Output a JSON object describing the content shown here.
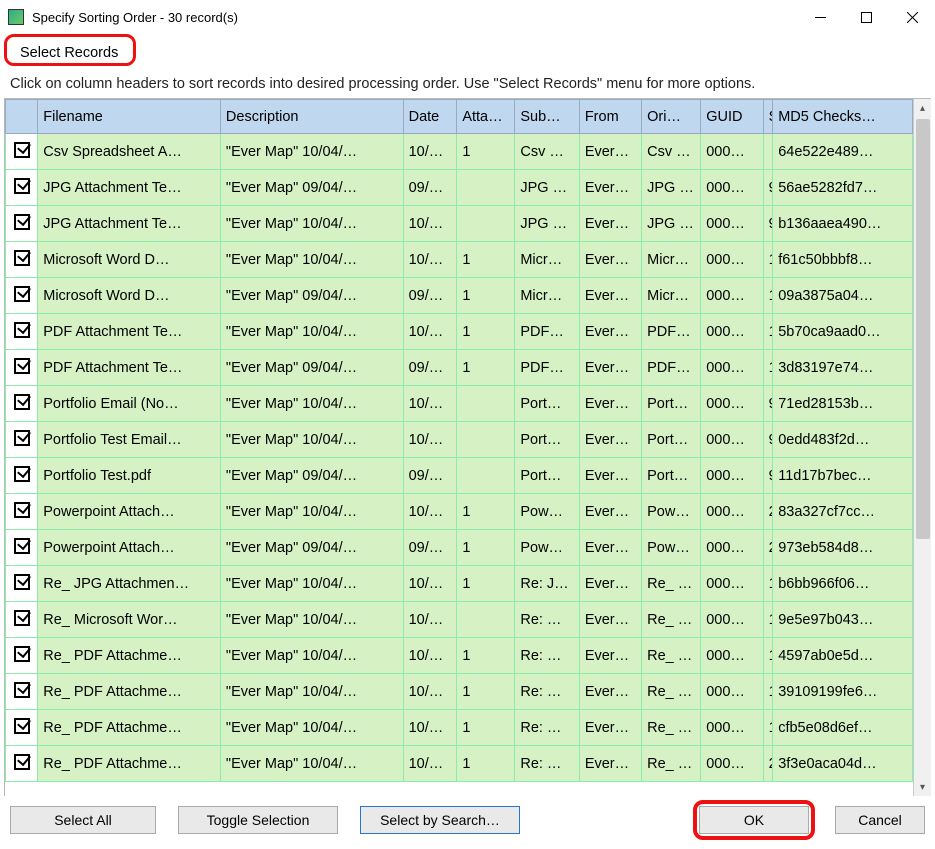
{
  "window": {
    "title": "Specify Sorting Order - 30 record(s)"
  },
  "menu": {
    "select_records": "Select Records"
  },
  "instruction": "Click on column headers to sort records into desired processing order. Use \"Select Records\" menu for more options.",
  "headers": {
    "filename": "Filename",
    "description": "Description",
    "date": "Date",
    "atta": "Atta…",
    "sub": "Sub…",
    "from": "From",
    "ori": "Ori…",
    "guid": "GUID",
    "q": "S",
    "md5": "MD5 Checks…"
  },
  "rows": [
    {
      "fn": "Csv Spreadsheet A…",
      "desc": "\"Ever Map\" 10/04/…",
      "date": "10/…",
      "att": "1",
      "sub": "Csv …",
      "from": "Ever…",
      "ori": "Csv …",
      "guid": "000…",
      "q": "",
      "md5": "64e522e489…"
    },
    {
      "fn": "JPG Attachment Te…",
      "desc": "\"Ever Map\" 09/04/…",
      "date": "09/…",
      "att": "",
      "sub": "JPG …",
      "from": "Ever…",
      "ori": "JPG …",
      "guid": "000…",
      "q": "9",
      "md5": "56ae5282fd7…"
    },
    {
      "fn": "JPG Attachment Te…",
      "desc": "\"Ever Map\" 10/04/…",
      "date": "10/…",
      "att": "",
      "sub": "JPG …",
      "from": "Ever…",
      "ori": "JPG …",
      "guid": "000…",
      "q": "9",
      "md5": "b136aaea490…"
    },
    {
      "fn": "Microsoft Word D…",
      "desc": "\"Ever Map\" 10/04/…",
      "date": "10/…",
      "att": "1",
      "sub": "Micr…",
      "from": "Ever…",
      "ori": "Micr…",
      "guid": "000…",
      "q": "1",
      "md5": "f61c50bbbf8…"
    },
    {
      "fn": "Microsoft Word D…",
      "desc": "\"Ever Map\" 09/04/…",
      "date": "09/…",
      "att": "1",
      "sub": "Micr…",
      "from": "Ever…",
      "ori": "Micr…",
      "guid": "000…",
      "q": "1",
      "md5": "09a3875a04…"
    },
    {
      "fn": "PDF Attachment Te…",
      "desc": "\"Ever Map\" 10/04/…",
      "date": "10/…",
      "att": "1",
      "sub": "PDF…",
      "from": "Ever…",
      "ori": "PDF…",
      "guid": "000…",
      "q": "1",
      "md5": "5b70ca9aad0…"
    },
    {
      "fn": "PDF Attachment Te…",
      "desc": "\"Ever Map\" 09/04/…",
      "date": "09/…",
      "att": "1",
      "sub": "PDF…",
      "from": "Ever…",
      "ori": "PDF…",
      "guid": "000…",
      "q": "1",
      "md5": "3d83197e74…"
    },
    {
      "fn": "Portfolio Email (No…",
      "desc": "\"Ever Map\" 10/04/…",
      "date": "10/…",
      "att": "",
      "sub": "Port…",
      "from": "Ever…",
      "ori": "Port…",
      "guid": "000…",
      "q": "9",
      "md5": "71ed28153b…"
    },
    {
      "fn": "Portfolio Test Email…",
      "desc": "\"Ever Map\" 10/04/…",
      "date": "10/…",
      "att": "",
      "sub": "Port…",
      "from": "Ever…",
      "ori": "Port…",
      "guid": "000…",
      "q": "9",
      "md5": "0edd483f2d…"
    },
    {
      "fn": "Portfolio Test.pdf",
      "desc": "\"Ever Map\" 09/04/…",
      "date": "09/…",
      "att": "",
      "sub": "Port…",
      "from": "Ever…",
      "ori": "Port…",
      "guid": "000…",
      "q": "9",
      "md5": "11d17b7bec…"
    },
    {
      "fn": "Powerpoint Attach…",
      "desc": "\"Ever Map\" 10/04/…",
      "date": "10/…",
      "att": "1",
      "sub": "Pow…",
      "from": "Ever…",
      "ori": "Pow…",
      "guid": "000…",
      "q": "2",
      "md5": "83a327cf7cc…"
    },
    {
      "fn": "Powerpoint Attach…",
      "desc": "\"Ever Map\" 09/04/…",
      "date": "09/…",
      "att": "1",
      "sub": "Pow…",
      "from": "Ever…",
      "ori": "Pow…",
      "guid": "000…",
      "q": "2",
      "md5": "973eb584d8…"
    },
    {
      "fn": "Re_ JPG Attachmen…",
      "desc": "\"Ever Map\" 10/04/…",
      "date": "10/…",
      "att": "1",
      "sub": "Re: J…",
      "from": "Ever…",
      "ori": "Re_ …",
      "guid": "000…",
      "q": "1",
      "md5": "b6bb966f06…"
    },
    {
      "fn": "Re_ Microsoft Wor…",
      "desc": "\"Ever Map\" 10/04/…",
      "date": "10/…",
      "att": "",
      "sub": "Re: …",
      "from": "Ever…",
      "ori": "Re_ …",
      "guid": "000…",
      "q": "1",
      "md5": "9e5e97b043…"
    },
    {
      "fn": "Re_ PDF Attachme…",
      "desc": "\"Ever Map\" 10/04/…",
      "date": "10/…",
      "att": "1",
      "sub": "Re: …",
      "from": "Ever…",
      "ori": "Re_ …",
      "guid": "000…",
      "q": "1",
      "md5": "4597ab0e5d…"
    },
    {
      "fn": "Re_ PDF Attachme…",
      "desc": "\"Ever Map\" 10/04/…",
      "date": "10/…",
      "att": "1",
      "sub": "Re: …",
      "from": "Ever…",
      "ori": "Re_ …",
      "guid": "000…",
      "q": "1",
      "md5": "39109199fe6…"
    },
    {
      "fn": "Re_ PDF Attachme…",
      "desc": "\"Ever Map\" 10/04/…",
      "date": "10/…",
      "att": "1",
      "sub": "Re: …",
      "from": "Ever…",
      "ori": "Re_ …",
      "guid": "000…",
      "q": "1",
      "md5": "cfb5e08d6ef…"
    },
    {
      "fn": "Re_ PDF Attachme…",
      "desc": "\"Ever Map\" 10/04/…",
      "date": "10/…",
      "att": "1",
      "sub": "Re: …",
      "from": "Ever…",
      "ori": "Re_ …",
      "guid": "000…",
      "q": "2",
      "md5": "3f3e0aca04d…"
    }
  ],
  "buttons": {
    "select_all": "Select All",
    "toggle": "Toggle Selection",
    "search": "Select by Search…",
    "ok": "OK",
    "cancel": "Cancel"
  }
}
